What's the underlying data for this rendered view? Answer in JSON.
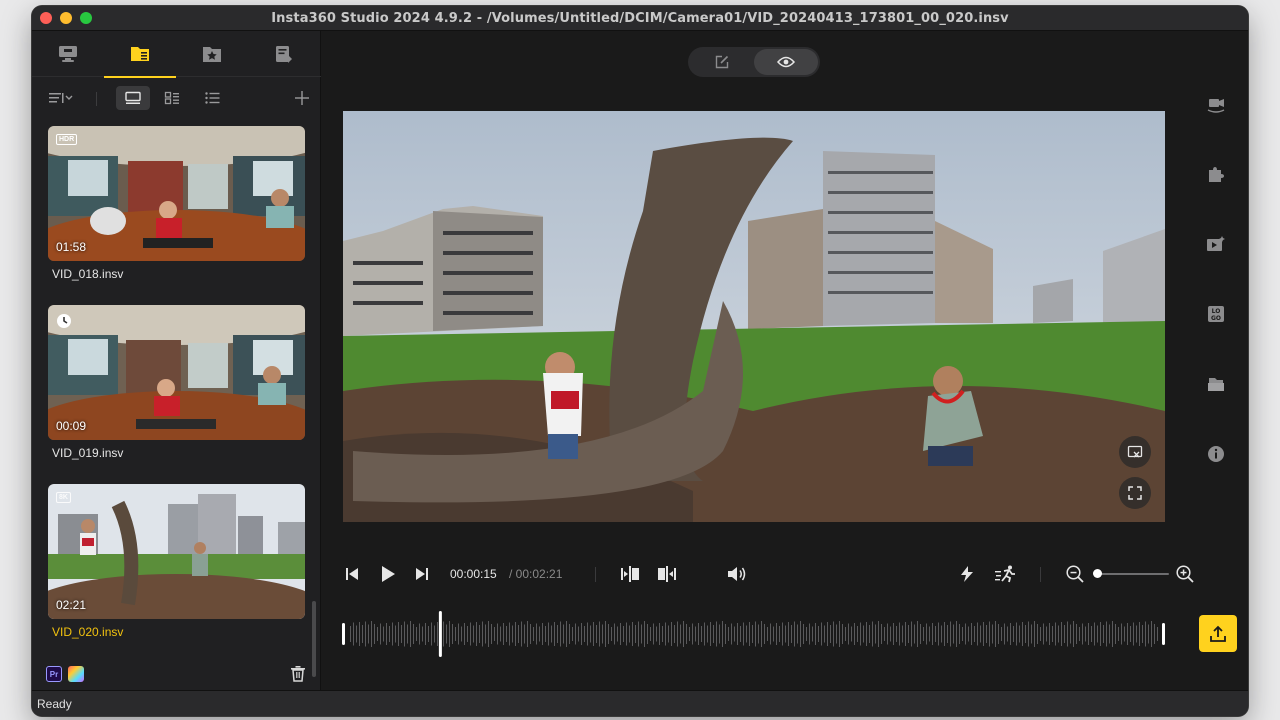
{
  "window": {
    "title": "Insta360 Studio 2024 4.9.2 - /Volumes/Untitled/DCIM/Camera01/VID_20240413_173801_00_020.insv"
  },
  "sidebar": {
    "tabs": [
      {
        "icon": "monitor-icon",
        "active": false
      },
      {
        "icon": "folder-card-icon",
        "active": true
      },
      {
        "icon": "star-box-icon",
        "active": false
      },
      {
        "icon": "export-list-icon",
        "active": false
      }
    ],
    "toolbar": {
      "sort_icon": "sort-icon",
      "views": [
        "large-thumbnail-view",
        "grid-view",
        "list-view"
      ],
      "add_icon": "plus-icon"
    },
    "clips": [
      {
        "name": "VID_018.insv",
        "duration": "01:58",
        "badge": "HDR",
        "selected": false
      },
      {
        "name": "VID_019.insv",
        "duration": "00:09",
        "badge": "timelapse-clock",
        "selected": false
      },
      {
        "name": "VID_020.insv",
        "duration": "02:21",
        "badge": "8K",
        "selected": true
      }
    ],
    "bottom": {
      "pr_label": "Pr"
    }
  },
  "main": {
    "mode_toggle": [
      "edit-icon",
      "preview-eye-icon"
    ],
    "active_mode": "preview",
    "controls": {
      "current_time": "00:00:15",
      "total_time": "/ 00:02:21",
      "zoom_level": 0.05
    },
    "timeline": {
      "playhead_fraction": 0.11
    }
  },
  "right_rail": [
    "camera-mode-icon",
    "plugin-puzzle-icon",
    "ai-edit-icon",
    "logo-icon",
    "template-icon",
    "info-icon"
  ],
  "colors": {
    "accent": "#ffd21e",
    "selected_text": "#f2c20f",
    "background": "#1a1a1a"
  },
  "statusbar": {
    "text": "Ready"
  }
}
